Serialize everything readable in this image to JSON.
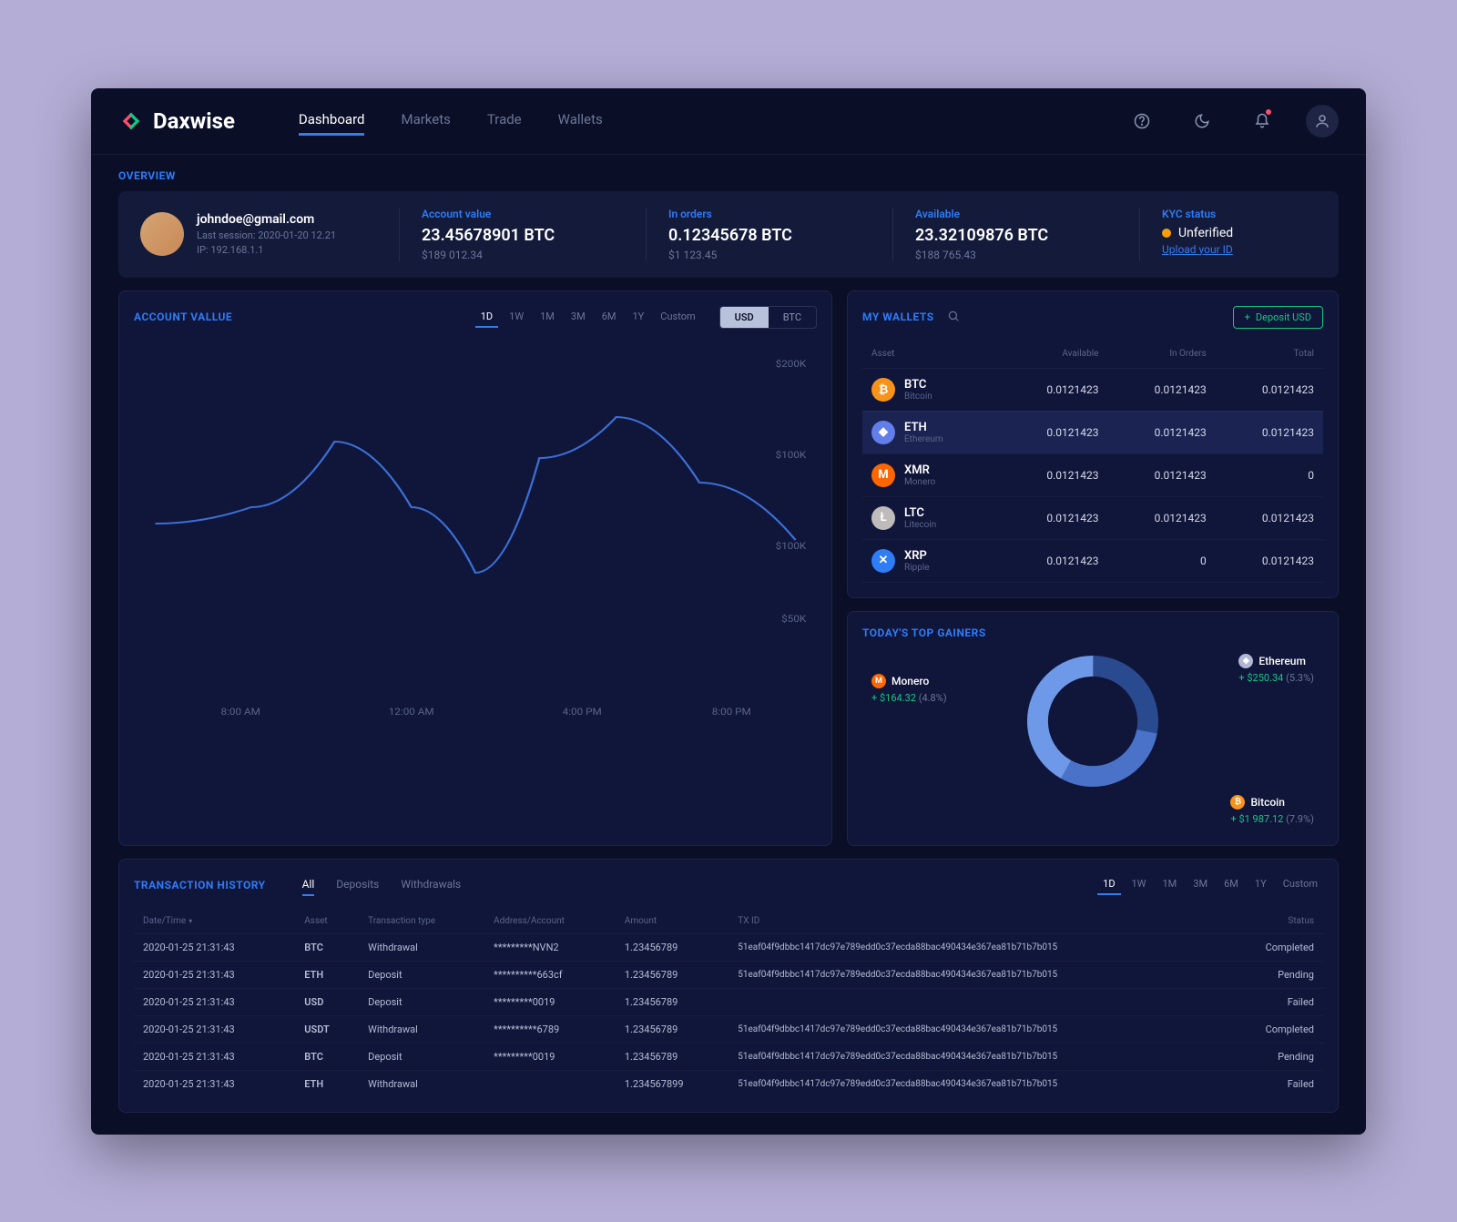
{
  "brand": "Daxwise",
  "nav": {
    "items": [
      "Dashboard",
      "Markets",
      "Trade",
      "Wallets"
    ],
    "active": 0
  },
  "overview": {
    "label": "OVERVIEW",
    "user": {
      "email": "johndoe@gmail.com",
      "last_session": "Last session: 2020-01-20 12.21",
      "ip": "IP: 192.168.1.1"
    },
    "stats": [
      {
        "label": "Account value",
        "value": "23.45678901 BTC",
        "sub": "$189 012.34"
      },
      {
        "label": "In orders",
        "value": "0.12345678 BTC",
        "sub": "$1 123.45"
      },
      {
        "label": "Available",
        "value": "23.32109876 BTC",
        "sub": "$188 765.43"
      }
    ],
    "kyc": {
      "label": "KYC status",
      "status": "Unferified",
      "link": "Upload your ID"
    }
  },
  "account_value": {
    "title": "ACCOUNT VALLUE",
    "ranges": [
      "1D",
      "1W",
      "1M",
      "3M",
      "6M",
      "1Y",
      "Custom"
    ],
    "active_range": 0,
    "currencies": [
      "USD",
      "BTC"
    ],
    "active_currency": 0,
    "chart_data": {
      "type": "line",
      "x": [
        "8:00 AM",
        "12:00 AM",
        "4:00 PM",
        "8:00 PM"
      ],
      "y_ticks": [
        "$200K",
        "$100K",
        "$100K",
        "$50K"
      ],
      "ylim": [
        0,
        200
      ],
      "series": [
        {
          "name": "Account value (USD)",
          "points": [
            {
              "x": 0,
              "y": 100
            },
            {
              "x": 15,
              "y": 110
            },
            {
              "x": 28,
              "y": 150
            },
            {
              "x": 40,
              "y": 110
            },
            {
              "x": 50,
              "y": 70
            },
            {
              "x": 60,
              "y": 140
            },
            {
              "x": 72,
              "y": 165
            },
            {
              "x": 85,
              "y": 125
            },
            {
              "x": 100,
              "y": 90
            }
          ]
        }
      ]
    }
  },
  "wallets": {
    "title": "MY WALLETS",
    "deposit_btn": "Deposit USD",
    "columns": [
      "Asset",
      "Available",
      "In Orders",
      "Total"
    ],
    "rows": [
      {
        "sym": "BTC",
        "name": "Bitcoin",
        "available": "0.0121423",
        "in_orders": "0.0121423",
        "total": "0.0121423",
        "icon": "btc"
      },
      {
        "sym": "ETH",
        "name": "Ethereum",
        "available": "0.0121423",
        "in_orders": "0.0121423",
        "total": "0.0121423",
        "icon": "eth",
        "selected": true
      },
      {
        "sym": "XMR",
        "name": "Monero",
        "available": "0.0121423",
        "in_orders": "0.0121423",
        "total": "0",
        "icon": "xmr"
      },
      {
        "sym": "LTC",
        "name": "Litecoin",
        "available": "0.0121423",
        "in_orders": "0.0121423",
        "total": "0.0121423",
        "icon": "ltc"
      },
      {
        "sym": "XRP",
        "name": "Ripple",
        "available": "0.0121423",
        "in_orders": "0",
        "total": "0.0121423",
        "icon": "xrp"
      }
    ]
  },
  "gainers": {
    "title": "TODAY'S TOP GAINERS",
    "items": [
      {
        "name": "Monero",
        "icon": "xmr",
        "delta": "+ $164.32",
        "pct": "(4.8%)",
        "share": 28
      },
      {
        "name": "Ethereum",
        "icon": "eth",
        "delta": "+ $250.34",
        "pct": "(5.3%)",
        "share": 30
      },
      {
        "name": "Bitcoin",
        "icon": "btc",
        "delta": "+ $1 987.12",
        "pct": "(7.9%)",
        "share": 42
      }
    ],
    "chart_data": {
      "type": "pie",
      "series": [
        {
          "name": "share",
          "values": [
            28,
            30,
            42
          ]
        }
      ],
      "categories": [
        "Monero",
        "Ethereum",
        "Bitcoin"
      ]
    }
  },
  "transactions": {
    "title": "TRANSACTION HISTORY",
    "tabs": [
      "All",
      "Deposits",
      "Withdrawals"
    ],
    "active_tab": 0,
    "ranges": [
      "1D",
      "1W",
      "1M",
      "3M",
      "6M",
      "1Y",
      "Custom"
    ],
    "active_range": 0,
    "columns": [
      "Date/Time",
      "Asset",
      "Transaction type",
      "Address/Account",
      "Amount",
      "TX ID",
      "Status"
    ],
    "rows": [
      {
        "date": "2020-01-25 21:31:43",
        "asset": "BTC",
        "type": "Withdrawal",
        "addr": "*********NVN2",
        "amount": "1.23456789",
        "txid": "51eaf04f9dbbc1417dc97e789edd0c37ecda88bac490434e367ea81b71b7b015",
        "status": "Completed"
      },
      {
        "date": "2020-01-25 21:31:43",
        "asset": "ETH",
        "type": "Deposit",
        "addr": "**********663cf",
        "amount": "1.23456789",
        "txid": "51eaf04f9dbbc1417dc97e789edd0c37ecda88bac490434e367ea81b71b7b015",
        "status": "Pending"
      },
      {
        "date": "2020-01-25 21:31:43",
        "asset": "USD",
        "type": "Deposit",
        "addr": "*********0019",
        "amount": "1.23456789",
        "txid": "",
        "status": "Failed"
      },
      {
        "date": "2020-01-25 21:31:43",
        "asset": "USDT",
        "type": "Withdrawal",
        "addr": "**********6789",
        "amount": "1.23456789",
        "txid": "51eaf04f9dbbc1417dc97e789edd0c37ecda88bac490434e367ea81b71b7b015",
        "status": "Completed"
      },
      {
        "date": "2020-01-25 21:31:43",
        "asset": "BTC",
        "type": "Deposit",
        "addr": "*********0019",
        "amount": "1.23456789",
        "txid": "51eaf04f9dbbc1417dc97e789edd0c37ecda88bac490434e367ea81b71b7b015",
        "status": "Pending"
      },
      {
        "date": "2020-01-25 21:31:43",
        "asset": "ETH",
        "type": "Withdrawal",
        "addr": "",
        "amount": "1.234567899",
        "txid": "51eaf04f9dbbc1417dc97e789edd0c37ecda88bac490434e367ea81b71b7b015",
        "status": "Failed"
      }
    ]
  }
}
